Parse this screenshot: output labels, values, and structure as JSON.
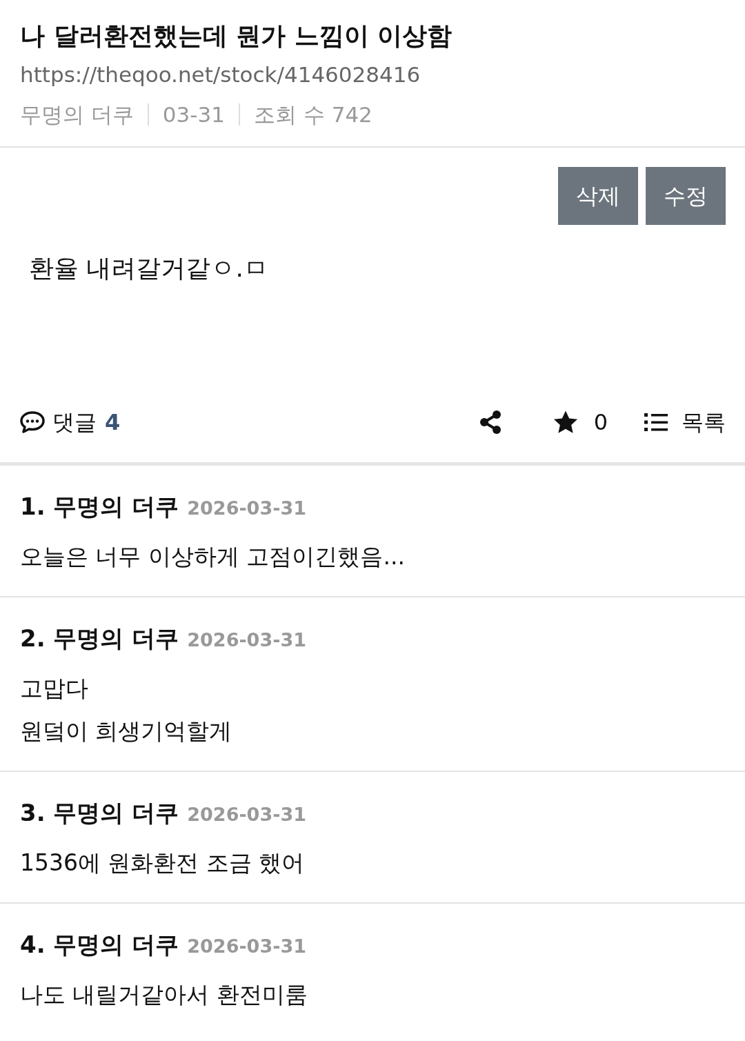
{
  "post": {
    "title": "나 달러환전했는데 뭔가 느낌이 이상함",
    "url": "https://theqoo.net/stock/4146028416",
    "meta": [
      "무명의 더쿠",
      "03-31",
      "조회 수 742"
    ]
  },
  "buttons": [
    "삭제",
    "수정"
  ],
  "body": "환율 내려갈거같ㅇ.ㅁ",
  "actions": {
    "comments_label": "댓글",
    "comments_count": "4",
    "stars": "0",
    "list_label": "목록"
  },
  "comments": [
    {
      "number": "1.",
      "author": "무명의 더쿠",
      "date": "2026-03-31",
      "lines": [
        "오늘은 너무 이상하게 고점이긴했음..."
      ]
    },
    {
      "number": "2.",
      "author": "무명의 더쿠",
      "date": "2026-03-31",
      "lines": [
        "고맙다",
        "원덬이 희생기억할게"
      ]
    },
    {
      "number": "3.",
      "author": "무명의 더쿠",
      "date": "2026-03-31",
      "lines": [
        "1536에 원화환전 조금 했어"
      ]
    },
    {
      "number": "4.",
      "author": "무명의 더쿠",
      "date": "2026-03-31",
      "lines": [
        "나도 내릴거같아서 환전미룸"
      ]
    }
  ]
}
